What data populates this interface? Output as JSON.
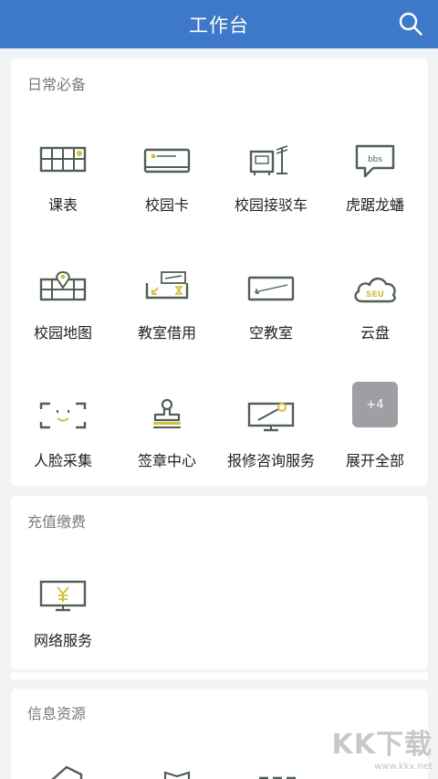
{
  "header": {
    "title": "工作台"
  },
  "colors": {
    "brand": "#3e78c8",
    "icon_stroke": "#4f5f53",
    "icon_accent": "#d3c23a"
  },
  "sections": {
    "daily": {
      "title": "日常必备",
      "items": [
        "课表",
        "校园卡",
        "校园接驳车",
        "虎踞龙蟠",
        "校园地图",
        "教室借用",
        "空教室",
        "云盘",
        "人脸采集",
        "签章中心",
        "报修咨询服务",
        "展开全部"
      ],
      "more_badge": "+4",
      "icons": [
        "grid-icon",
        "card-icon",
        "shuttle-icon",
        "chat-bubble-icon",
        "map-pin-icon",
        "classroom-icon",
        "empty-room-icon",
        "cloud-icon",
        "face-scan-icon",
        "stamp-icon",
        "repair-icon",
        "expand-icon"
      ],
      "icon_texts": {
        "forum": "bbs",
        "cloud": "SEU"
      }
    },
    "payment": {
      "title": "充值缴费",
      "items": [
        "网络服务"
      ],
      "icons": [
        "network-icon"
      ]
    },
    "resources": {
      "title": "信息资源",
      "icons": [
        "house-icon",
        "book-icon",
        "list-icon",
        "book-icon"
      ]
    }
  },
  "watermark": {
    "text": "KK下载",
    "sub": "www.kkx.net"
  }
}
